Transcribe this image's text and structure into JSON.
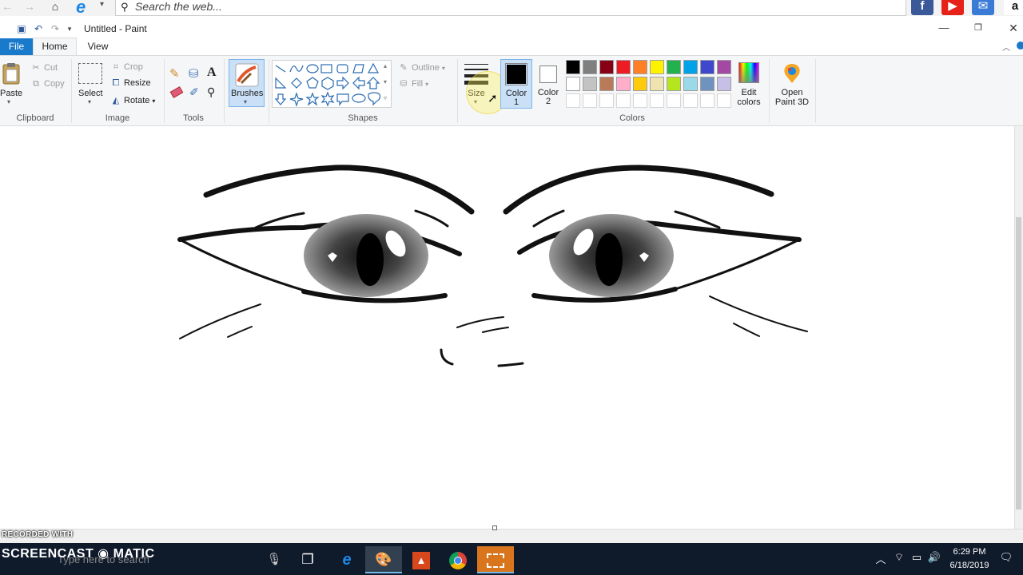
{
  "browser": {
    "search_placeholder": "Search the web...",
    "social_labels": [
      "f",
      "▶",
      "✉",
      "a"
    ]
  },
  "window": {
    "title": "Untitled - Paint"
  },
  "tabs": {
    "file": "File",
    "home": "Home",
    "view": "View"
  },
  "clipboard": {
    "paste": "Paste",
    "cut": "Cut",
    "copy": "Copy",
    "group": "Clipboard"
  },
  "image": {
    "select": "Select",
    "crop": "Crop",
    "resize": "Resize",
    "rotate": "Rotate",
    "group": "Image"
  },
  "tools": {
    "group": "Tools"
  },
  "brushes": {
    "label": "Brushes"
  },
  "shapes": {
    "outline": "Outline",
    "fill": "Fill",
    "group": "Shapes"
  },
  "size": {
    "label": "Size"
  },
  "color1": {
    "label": "Color",
    "num": "1",
    "value": "#000000"
  },
  "color2": {
    "label": "Color",
    "num": "2",
    "value": "#ffffff"
  },
  "colors": {
    "group": "Colors",
    "edit": "Edit colors",
    "row1": [
      "#000000",
      "#7f7f7f",
      "#880015",
      "#ed1c24",
      "#ff7f27",
      "#fff200",
      "#22b14c",
      "#00a2e8",
      "#3f48cc",
      "#a349a4"
    ],
    "row2": [
      "#ffffff",
      "#c3c3c3",
      "#b97a57",
      "#ffaec9",
      "#ffc90e",
      "#efe4b0",
      "#b5e61d",
      "#99d9ea",
      "#7092be",
      "#c8bfe7"
    ]
  },
  "paint3d": {
    "label": "Open Paint 3D"
  },
  "taskbar": {
    "search_placeholder": "Type here to search",
    "time": "6:29 PM",
    "date": "6/18/2019"
  },
  "watermark": {
    "recorded": "RECORDED WITH",
    "brand": "SCREENCAST ◉ MATIC"
  },
  "accent": "#1979ca"
}
